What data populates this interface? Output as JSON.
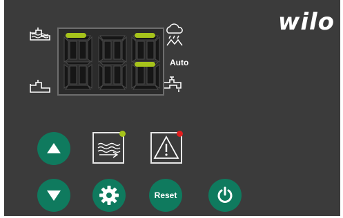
{
  "brand": {
    "logo_text": "wilo"
  },
  "display": {
    "auto_label": "Auto",
    "icons": [
      "tank-full-icon",
      "tank-empty-icon",
      "rain-cloud-icon",
      "tap-icon"
    ]
  },
  "buttons": {
    "up": {
      "icon": "arrow-up-icon"
    },
    "down": {
      "icon": "arrow-down-icon"
    },
    "settings": {
      "icon": "gear-icon"
    },
    "reset": {
      "label": "Reset"
    },
    "power": {
      "icon": "power-icon"
    },
    "mode_water": {
      "icon": "water-level-icon",
      "status_color": "#a6c31b"
    },
    "alarm": {
      "icon": "warning-triangle-icon",
      "status_color": "#e01e1e"
    }
  },
  "colors": {
    "panel": "#3b3b3b",
    "button": "#0f7a5e",
    "indicator": "#a6c31b"
  }
}
